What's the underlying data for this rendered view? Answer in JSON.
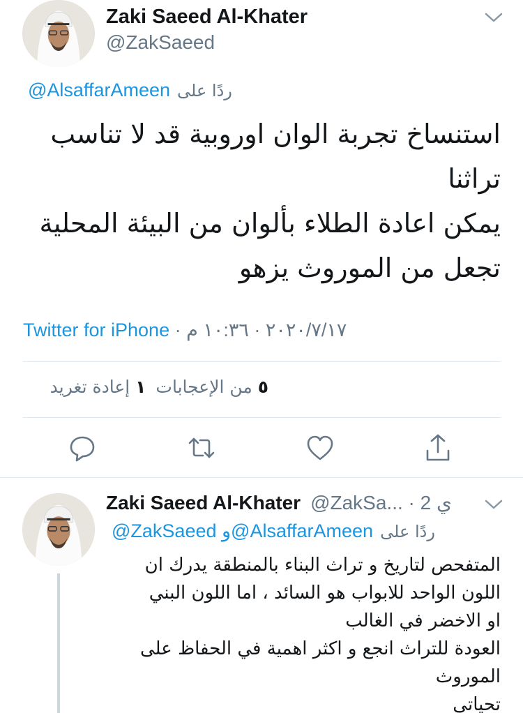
{
  "main_tweet": {
    "author_name": "Zaki Saeed Al-Khater",
    "author_handle": "@ZakSaeed",
    "reply_to_prefix": "ردًا على",
    "reply_to_handle": "@AlsaffarAmeen",
    "text_lines": [
      "استنساخ تجربة الوان اوروبية قد لا تناسب",
      "تراثنا",
      "يمكن اعادة الطلاء بألوان من البيئة المحلية",
      "تجعل من الموروث يزهو"
    ],
    "source": "Twitter for iPhone",
    "date": "٢٠٢٠/٧/١٧",
    "time": "١٠:٣٦ م",
    "separator": " · ",
    "likes_count": "٥",
    "likes_label": "من الإعجابات",
    "retweets_count": "١",
    "retweets_label": "إعادة تغريد",
    "icons": {
      "caret": "chevron-down-icon",
      "reply": "reply-icon",
      "retweet": "retweet-icon",
      "like": "heart-icon",
      "share": "share-icon"
    }
  },
  "reply_tweet": {
    "author_name": "Zaki Saeed Al-Khater",
    "author_handle": "@ZakSa...",
    "time_ago": "2 ي",
    "separator": " · ",
    "reply_to_prefix": "ردًا على",
    "reply_to_handles": "@ZakSaeed و@AlsaffarAmeen",
    "text_lines": [
      "المتفحص لتاريخ و تراث البناء بالمنطقة يدرك ان",
      "اللون الواحد للابواب هو السائد ، اما اللون البني",
      "او الاخضر في الغالب",
      "العودة للتراث انجع و اكثر اهمية في الحفاظ على",
      "الموروث",
      "تحياتي"
    ]
  },
  "colors": {
    "link": "#1b95e0",
    "secondary_text": "#657786",
    "primary_text": "#14171a",
    "divider": "#e1e8ed",
    "thread_line": "#ccd6dd"
  }
}
